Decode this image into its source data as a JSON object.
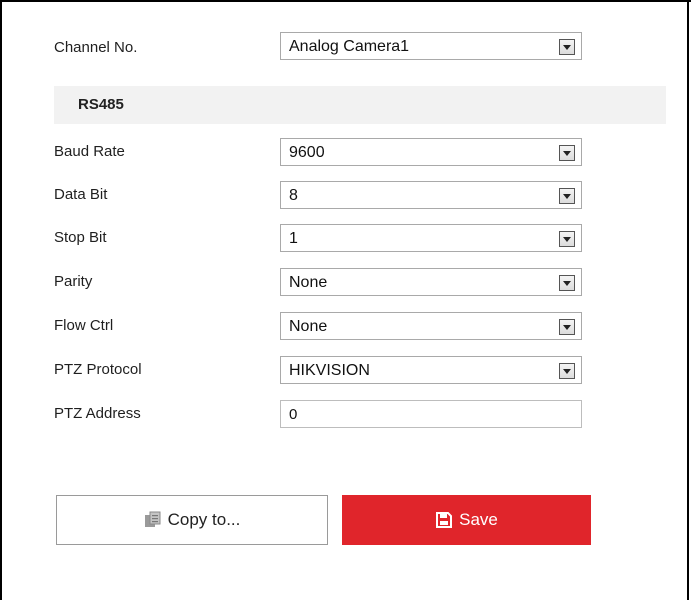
{
  "channel": {
    "label": "Channel No.",
    "value": "Analog Camera1"
  },
  "section": {
    "title": "RS485"
  },
  "fields": {
    "baud_rate": {
      "label": "Baud Rate",
      "value": "9600"
    },
    "data_bit": {
      "label": "Data Bit",
      "value": "8"
    },
    "stop_bit": {
      "label": "Stop Bit",
      "value": "1"
    },
    "parity": {
      "label": "Parity",
      "value": "None"
    },
    "flow_ctrl": {
      "label": "Flow Ctrl",
      "value": "None"
    },
    "ptz_protocol": {
      "label": "PTZ Protocol",
      "value": "HIKVISION"
    },
    "ptz_address": {
      "label": "PTZ Address",
      "value": "0"
    }
  },
  "buttons": {
    "copy_label": "Copy to...",
    "save_label": "Save"
  },
  "colors": {
    "save_bg": "#e0252b",
    "section_bg": "#f2f2f2"
  },
  "icons": {
    "copy": "copy-icon",
    "save": "floppy-disk-icon",
    "dropdown": "chevron-down-icon"
  }
}
